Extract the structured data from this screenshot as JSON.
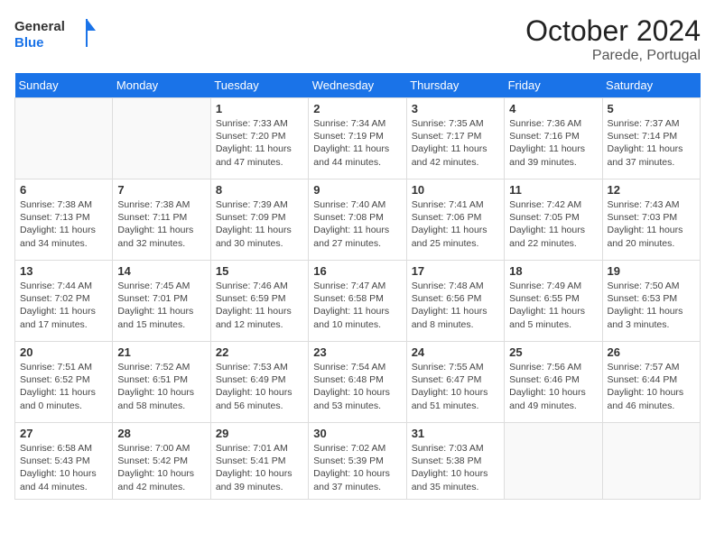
{
  "header": {
    "logo_line1": "General",
    "logo_line2": "Blue",
    "month": "October 2024",
    "location": "Parede, Portugal"
  },
  "weekdays": [
    "Sunday",
    "Monday",
    "Tuesday",
    "Wednesday",
    "Thursday",
    "Friday",
    "Saturday"
  ],
  "weeks": [
    [
      {
        "day": null,
        "sunrise": null,
        "sunset": null,
        "daylight": null
      },
      {
        "day": null,
        "sunrise": null,
        "sunset": null,
        "daylight": null
      },
      {
        "day": "1",
        "sunrise": "Sunrise: 7:33 AM",
        "sunset": "Sunset: 7:20 PM",
        "daylight": "Daylight: 11 hours and 47 minutes."
      },
      {
        "day": "2",
        "sunrise": "Sunrise: 7:34 AM",
        "sunset": "Sunset: 7:19 PM",
        "daylight": "Daylight: 11 hours and 44 minutes."
      },
      {
        "day": "3",
        "sunrise": "Sunrise: 7:35 AM",
        "sunset": "Sunset: 7:17 PM",
        "daylight": "Daylight: 11 hours and 42 minutes."
      },
      {
        "day": "4",
        "sunrise": "Sunrise: 7:36 AM",
        "sunset": "Sunset: 7:16 PM",
        "daylight": "Daylight: 11 hours and 39 minutes."
      },
      {
        "day": "5",
        "sunrise": "Sunrise: 7:37 AM",
        "sunset": "Sunset: 7:14 PM",
        "daylight": "Daylight: 11 hours and 37 minutes."
      }
    ],
    [
      {
        "day": "6",
        "sunrise": "Sunrise: 7:38 AM",
        "sunset": "Sunset: 7:13 PM",
        "daylight": "Daylight: 11 hours and 34 minutes."
      },
      {
        "day": "7",
        "sunrise": "Sunrise: 7:38 AM",
        "sunset": "Sunset: 7:11 PM",
        "daylight": "Daylight: 11 hours and 32 minutes."
      },
      {
        "day": "8",
        "sunrise": "Sunrise: 7:39 AM",
        "sunset": "Sunset: 7:09 PM",
        "daylight": "Daylight: 11 hours and 30 minutes."
      },
      {
        "day": "9",
        "sunrise": "Sunrise: 7:40 AM",
        "sunset": "Sunset: 7:08 PM",
        "daylight": "Daylight: 11 hours and 27 minutes."
      },
      {
        "day": "10",
        "sunrise": "Sunrise: 7:41 AM",
        "sunset": "Sunset: 7:06 PM",
        "daylight": "Daylight: 11 hours and 25 minutes."
      },
      {
        "day": "11",
        "sunrise": "Sunrise: 7:42 AM",
        "sunset": "Sunset: 7:05 PM",
        "daylight": "Daylight: 11 hours and 22 minutes."
      },
      {
        "day": "12",
        "sunrise": "Sunrise: 7:43 AM",
        "sunset": "Sunset: 7:03 PM",
        "daylight": "Daylight: 11 hours and 20 minutes."
      }
    ],
    [
      {
        "day": "13",
        "sunrise": "Sunrise: 7:44 AM",
        "sunset": "Sunset: 7:02 PM",
        "daylight": "Daylight: 11 hours and 17 minutes."
      },
      {
        "day": "14",
        "sunrise": "Sunrise: 7:45 AM",
        "sunset": "Sunset: 7:01 PM",
        "daylight": "Daylight: 11 hours and 15 minutes."
      },
      {
        "day": "15",
        "sunrise": "Sunrise: 7:46 AM",
        "sunset": "Sunset: 6:59 PM",
        "daylight": "Daylight: 11 hours and 12 minutes."
      },
      {
        "day": "16",
        "sunrise": "Sunrise: 7:47 AM",
        "sunset": "Sunset: 6:58 PM",
        "daylight": "Daylight: 11 hours and 10 minutes."
      },
      {
        "day": "17",
        "sunrise": "Sunrise: 7:48 AM",
        "sunset": "Sunset: 6:56 PM",
        "daylight": "Daylight: 11 hours and 8 minutes."
      },
      {
        "day": "18",
        "sunrise": "Sunrise: 7:49 AM",
        "sunset": "Sunset: 6:55 PM",
        "daylight": "Daylight: 11 hours and 5 minutes."
      },
      {
        "day": "19",
        "sunrise": "Sunrise: 7:50 AM",
        "sunset": "Sunset: 6:53 PM",
        "daylight": "Daylight: 11 hours and 3 minutes."
      }
    ],
    [
      {
        "day": "20",
        "sunrise": "Sunrise: 7:51 AM",
        "sunset": "Sunset: 6:52 PM",
        "daylight": "Daylight: 11 hours and 0 minutes."
      },
      {
        "day": "21",
        "sunrise": "Sunrise: 7:52 AM",
        "sunset": "Sunset: 6:51 PM",
        "daylight": "Daylight: 10 hours and 58 minutes."
      },
      {
        "day": "22",
        "sunrise": "Sunrise: 7:53 AM",
        "sunset": "Sunset: 6:49 PM",
        "daylight": "Daylight: 10 hours and 56 minutes."
      },
      {
        "day": "23",
        "sunrise": "Sunrise: 7:54 AM",
        "sunset": "Sunset: 6:48 PM",
        "daylight": "Daylight: 10 hours and 53 minutes."
      },
      {
        "day": "24",
        "sunrise": "Sunrise: 7:55 AM",
        "sunset": "Sunset: 6:47 PM",
        "daylight": "Daylight: 10 hours and 51 minutes."
      },
      {
        "day": "25",
        "sunrise": "Sunrise: 7:56 AM",
        "sunset": "Sunset: 6:46 PM",
        "daylight": "Daylight: 10 hours and 49 minutes."
      },
      {
        "day": "26",
        "sunrise": "Sunrise: 7:57 AM",
        "sunset": "Sunset: 6:44 PM",
        "daylight": "Daylight: 10 hours and 46 minutes."
      }
    ],
    [
      {
        "day": "27",
        "sunrise": "Sunrise: 6:58 AM",
        "sunset": "Sunset: 5:43 PM",
        "daylight": "Daylight: 10 hours and 44 minutes."
      },
      {
        "day": "28",
        "sunrise": "Sunrise: 7:00 AM",
        "sunset": "Sunset: 5:42 PM",
        "daylight": "Daylight: 10 hours and 42 minutes."
      },
      {
        "day": "29",
        "sunrise": "Sunrise: 7:01 AM",
        "sunset": "Sunset: 5:41 PM",
        "daylight": "Daylight: 10 hours and 39 minutes."
      },
      {
        "day": "30",
        "sunrise": "Sunrise: 7:02 AM",
        "sunset": "Sunset: 5:39 PM",
        "daylight": "Daylight: 10 hours and 37 minutes."
      },
      {
        "day": "31",
        "sunrise": "Sunrise: 7:03 AM",
        "sunset": "Sunset: 5:38 PM",
        "daylight": "Daylight: 10 hours and 35 minutes."
      },
      {
        "day": null,
        "sunrise": null,
        "sunset": null,
        "daylight": null
      },
      {
        "day": null,
        "sunrise": null,
        "sunset": null,
        "daylight": null
      }
    ]
  ]
}
